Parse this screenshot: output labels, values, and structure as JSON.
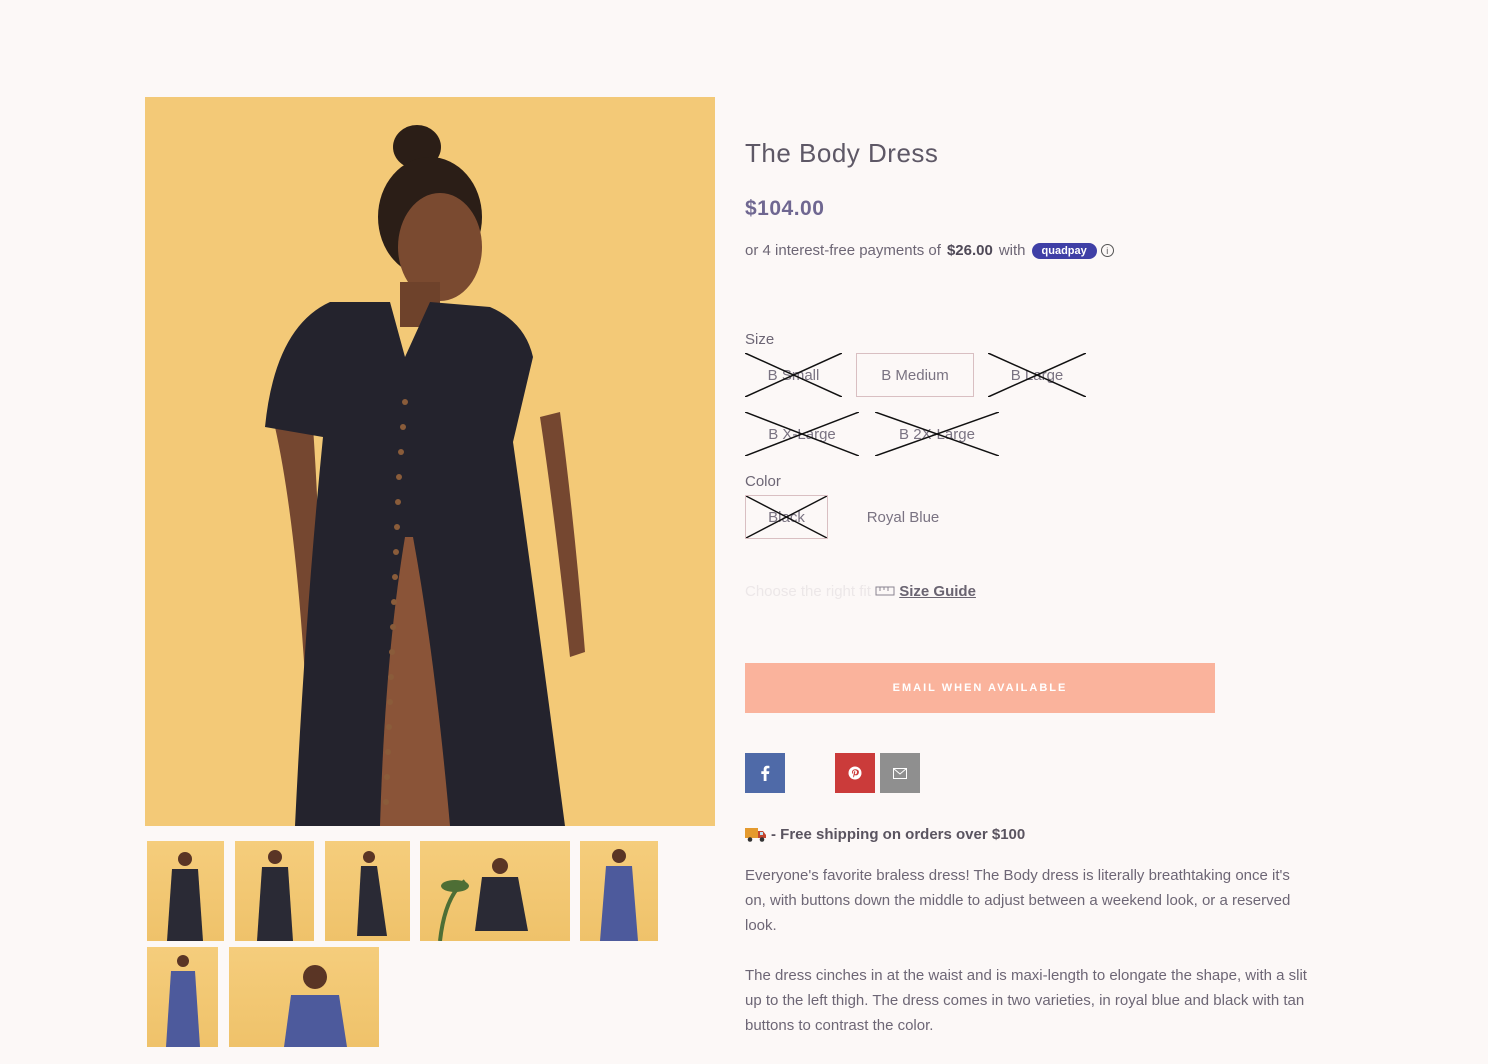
{
  "product": {
    "title": "The Body Dress",
    "price": "$104.00",
    "installments": {
      "prefix": "or 4 interest-free payments of",
      "amount": "$26.00",
      "suffix": "with",
      "provider": "quadpay",
      "info_icon": "info-icon"
    }
  },
  "options": {
    "size": {
      "label": "Size",
      "values": [
        {
          "label": "B Small",
          "available": false
        },
        {
          "label": "B Medium",
          "available": true,
          "selected": true
        },
        {
          "label": "B Large",
          "available": false
        },
        {
          "label": "B X-Large",
          "available": false
        },
        {
          "label": "B 2X-Large",
          "available": false
        }
      ]
    },
    "color": {
      "label": "Color",
      "values": [
        {
          "label": "Black",
          "available": false
        },
        {
          "label": "Royal Blue",
          "available": true
        }
      ]
    }
  },
  "size_guide": {
    "faded_text": "Choose the right fit",
    "icon": "ruler-icon",
    "link_label": "Size Guide"
  },
  "cta": {
    "label": "EMAIL WHEN AVAILABLE",
    "color": "#fab39c"
  },
  "share": {
    "facebook_icon": "facebook-icon",
    "pinterest_icon": "pinterest-icon",
    "email_icon": "mail-icon",
    "colors": {
      "facebook": "#4f6aa8",
      "pinterest": "#cb3b3a",
      "email": "#8f8f8f"
    }
  },
  "shipping": {
    "icon": "truck-icon",
    "text": "- Free shipping on orders over $100"
  },
  "description": {
    "p1": "Everyone's favorite braless dress! The Body dress is literally breathtaking once it's on, with buttons down the middle to adjust between a weekend look, or a reserved look.",
    "p2": "The dress cinches in at the waist and is maxi-length to elongate the shape, with a slit up to the left thigh. The dress comes in two varieties, in royal blue and black with tan buttons to contrast the color."
  },
  "gallery": {
    "thumbnails": [
      {
        "dress_color": "#2a2a35"
      },
      {
        "dress_color": "#2a2a35"
      },
      {
        "dress_color": "#2a2a35"
      },
      {
        "dress_color": "#2a2a35"
      },
      {
        "dress_color": "#4d5a9c"
      },
      {
        "dress_color": "#4d5a9c"
      },
      {
        "dress_color": "#4d5a9c"
      }
    ]
  }
}
